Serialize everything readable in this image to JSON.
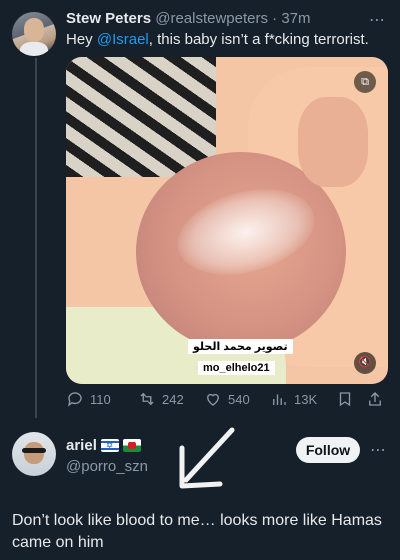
{
  "tweet": {
    "author_name": "Stew Peters",
    "author_handle": "@realstewpeters",
    "time": "37m",
    "text_prefix": "Hey ",
    "mention": "@Israel",
    "text_suffix": ", this baby isn’t a f*cking terrorist.",
    "media": {
      "watermark_arabic": "تصوير محمد الحلو",
      "watermark_handle": "mo_elhelo21",
      "badge_icon": "gif-icon",
      "mute_icon": "mute-icon"
    },
    "stats": {
      "replies": "110",
      "retweets": "242",
      "likes": "540",
      "views": "13K"
    }
  },
  "reply": {
    "author_name": "ariel",
    "author_handle": "@porro_szn",
    "flags": [
      "israel-flag",
      "wales-flag"
    ],
    "follow_label": "Follow",
    "text": "Don’t look like blood to me… looks more like Hamas came on him"
  },
  "icons": {
    "more": "⋯",
    "dots_color": "#8b98a5",
    "accent": "#1d9bf0",
    "background": "#15202b"
  }
}
